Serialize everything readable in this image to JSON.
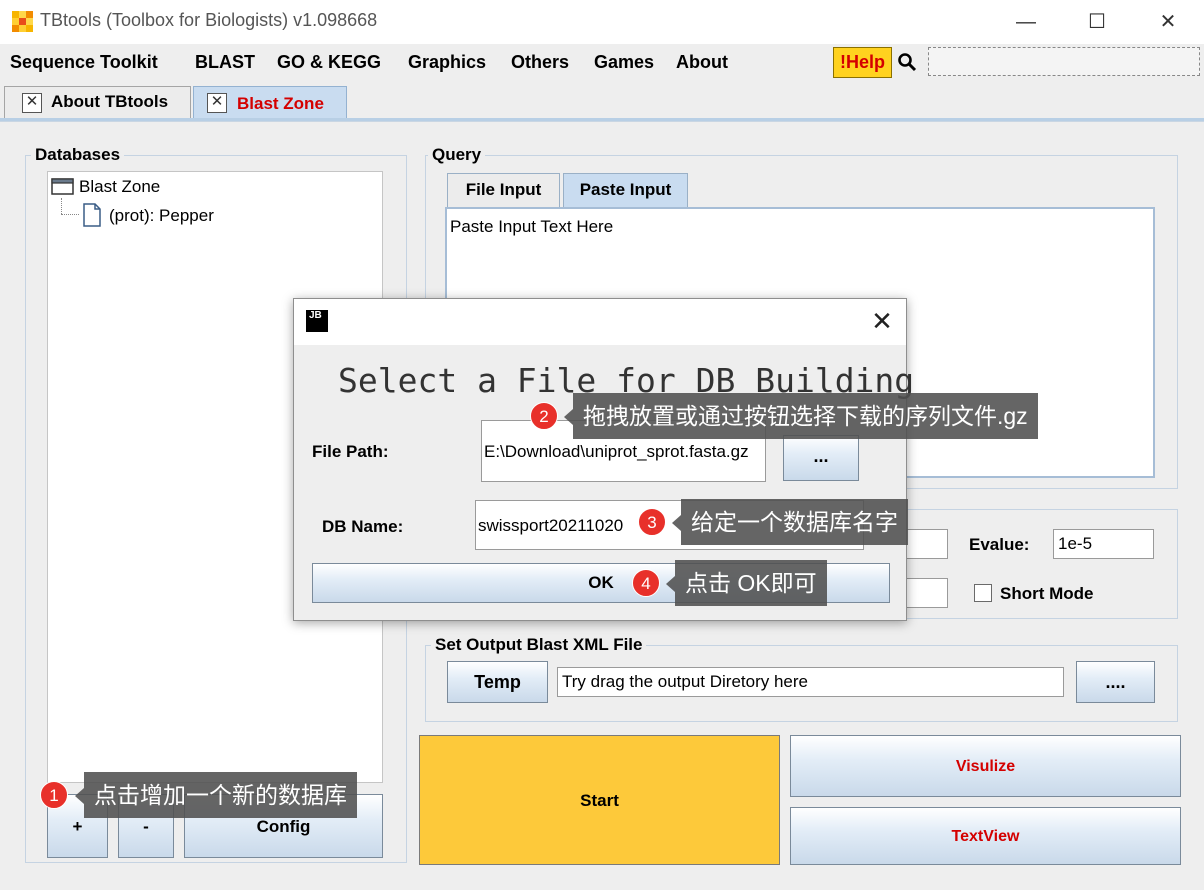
{
  "window": {
    "title": "TBtools (Toolbox for Biologists) v1.098668",
    "minimize": "—",
    "maximize": "☐",
    "close": "✕"
  },
  "menu": [
    "Sequence Toolkit",
    "BLAST",
    "GO & KEGG",
    "Graphics",
    "Others",
    "Games",
    "About"
  ],
  "help_label": "!Help",
  "tabs": [
    {
      "label": "About TBtools",
      "active": false
    },
    {
      "label": "Blast Zone",
      "active": true
    }
  ],
  "databases": {
    "title": "Databases",
    "tree_root": "Blast Zone",
    "tree_child": "(prot): Pepper",
    "add_button": "+",
    "remove_button": "-",
    "config_button": "Config"
  },
  "query": {
    "title": "Query",
    "tabs": [
      "File Input",
      "Paste Input"
    ],
    "active_tab": "Paste Input",
    "placeholder": "Paste Input Text Here"
  },
  "params": {
    "evalue_label": "Evalue:",
    "evalue_value": "1e-5",
    "short_mode_label": "Short Mode",
    "short_mode_checked": false
  },
  "output": {
    "title": "Set Output Blast XML File",
    "temp_button": "Temp",
    "path_placeholder": "Try drag the output Diretory here",
    "browse_button": "...."
  },
  "actions": {
    "start": "Start",
    "visualize": "Visulize",
    "textview": "TextView"
  },
  "dialog": {
    "icon_text": "JB",
    "close": "✕",
    "heading": "Select a File for DB Building",
    "file_path_label": "File Path:",
    "file_path_value": "E:\\Download\\uniprot_sprot.fasta.gz",
    "browse_button": "...",
    "db_name_label": "DB Name:",
    "db_name_value": "swissport20211020",
    "ok_button": "OK"
  },
  "annotations": [
    {
      "number": "1",
      "text": "点击增加一个新的数据库"
    },
    {
      "number": "2",
      "text": "拖拽放置或通过按钮选择下载的序列文件.gz"
    },
    {
      "number": "3",
      "text": "给定一个数据库名字"
    },
    {
      "number": "4",
      "text": "点击 OK即可"
    }
  ],
  "colors": {
    "start_button": "#fdc93a",
    "action_text": "#d40000",
    "active_tab_text": "#d40000",
    "help_bg": "#ffd21f",
    "badge": "#e8302a"
  }
}
